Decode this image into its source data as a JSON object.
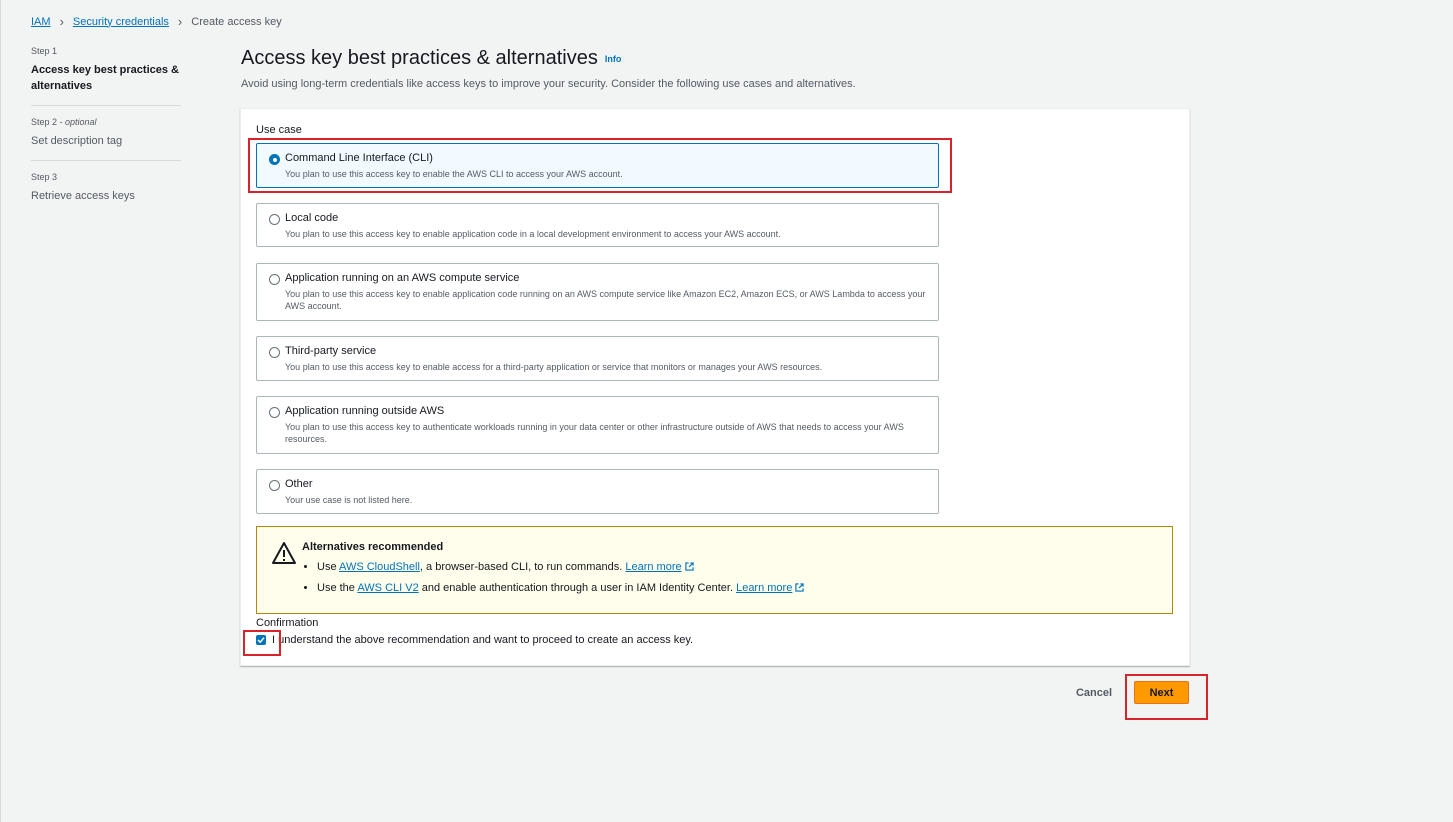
{
  "breadcrumb": {
    "items": [
      "IAM",
      "Security credentials"
    ],
    "current": "Create access key"
  },
  "steps": [
    {
      "num": "Step 1",
      "title": "Access key best practices & alternatives",
      "optional": ""
    },
    {
      "num": "Step 2",
      "title": "Set description tag",
      "optional": "optional"
    },
    {
      "num": "Step 3",
      "title": "Retrieve access keys",
      "optional": ""
    }
  ],
  "header": {
    "title": "Access key best practices & alternatives",
    "info": "Info",
    "description": "Avoid using long-term credentials like access keys to improve your security. Consider the following use cases and alternatives."
  },
  "use_case": {
    "label": "Use case",
    "selected_index": 0,
    "options": [
      {
        "title": "Command Line Interface (CLI)",
        "desc": "You plan to use this access key to enable the AWS CLI to access your AWS account."
      },
      {
        "title": "Local code",
        "desc": "You plan to use this access key to enable application code in a local development environment to access your AWS account."
      },
      {
        "title": "Application running on an AWS compute service",
        "desc": "You plan to use this access key to enable application code running on an AWS compute service like Amazon EC2, Amazon ECS, or AWS Lambda to access your AWS account."
      },
      {
        "title": "Third-party service",
        "desc": "You plan to use this access key to enable access for a third-party application or service that monitors or manages your AWS resources."
      },
      {
        "title": "Application running outside AWS",
        "desc": "You plan to use this access key to authenticate workloads running in your data center or other infrastructure outside of AWS that needs to access your AWS resources."
      },
      {
        "title": "Other",
        "desc": "Your use case is not listed here."
      }
    ]
  },
  "alert": {
    "title": "Alternatives recommended",
    "item1": {
      "prefix": "Use ",
      "link": "AWS CloudShell",
      "suffix": ", a browser-based CLI, to run commands. ",
      "learn": "Learn more"
    },
    "item2": {
      "prefix": "Use the ",
      "link": "AWS CLI V2",
      "suffix": " and enable authentication through a user in IAM Identity Center. ",
      "learn": "Learn more"
    }
  },
  "confirmation": {
    "label": "Confirmation",
    "checkbox_text": "I understand the above recommendation and want to proceed to create an access key.",
    "checked": true
  },
  "footer": {
    "cancel": "Cancel",
    "next": "Next"
  },
  "colors": {
    "link": "#0073bb",
    "primary_button": "#ff9900",
    "highlight": "#d8232a",
    "alert_bg": "#fffdeb"
  }
}
